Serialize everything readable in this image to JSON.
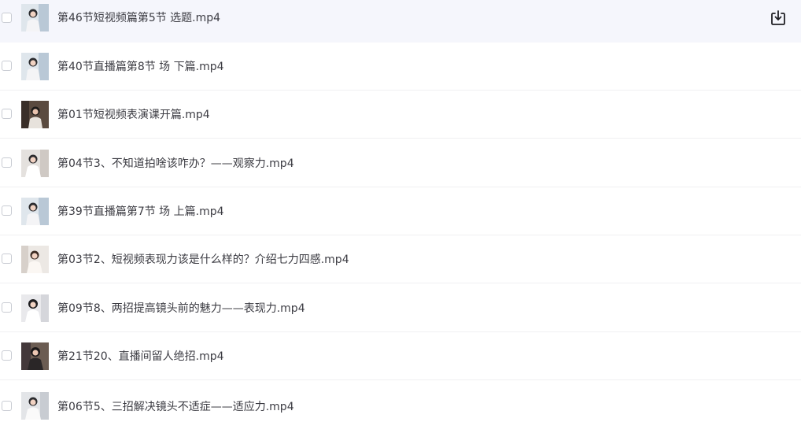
{
  "files": [
    {
      "name": "第46节短视频篇第5节 选题.mp4",
      "thumb_icon": "video-thumbnail-icon",
      "checked": false,
      "selected": true,
      "action_icon": "download-icon"
    },
    {
      "name": "第40节直播篇第8节 场 下篇.mp4",
      "thumb_icon": "video-thumbnail-icon",
      "checked": false,
      "selected": false
    },
    {
      "name": "第01节短视频表演课开篇.mp4",
      "thumb_icon": "video-thumbnail-icon",
      "checked": false,
      "selected": false
    },
    {
      "name": "第04节3、不知道拍啥该咋办？——观察力.mp4",
      "thumb_icon": "video-thumbnail-icon",
      "checked": false,
      "selected": false
    },
    {
      "name": "第39节直播篇第7节 场 上篇.mp4",
      "thumb_icon": "video-thumbnail-icon",
      "checked": false,
      "selected": false
    },
    {
      "name": "第03节2、短视频表现力该是什么样的？介绍七力四感.mp4",
      "thumb_icon": "video-thumbnail-icon",
      "checked": false,
      "selected": false
    },
    {
      "name": "第09节8、两招提高镜头前的魅力——表现力.mp4",
      "thumb_icon": "video-thumbnail-icon",
      "checked": false,
      "selected": false
    },
    {
      "name": "第21节20、直播间留人绝招.mp4",
      "thumb_icon": "video-thumbnail-icon",
      "checked": false,
      "selected": false
    },
    {
      "name": "第06节5、三招解决镜头不适症——适应力.mp4",
      "thumb_icon": "video-thumbnail-icon",
      "checked": false,
      "selected": false
    }
  ],
  "colors": {
    "selected_row_bg": "#f5f6fc",
    "text": "#3c3c43",
    "divider": "#f0f0f2"
  }
}
